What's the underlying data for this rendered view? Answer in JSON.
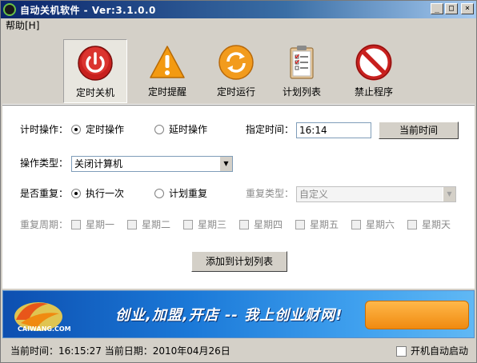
{
  "window": {
    "title": "自动关机软件 - Ver:3.1.0.0",
    "controls": [
      "_",
      "□",
      "×"
    ]
  },
  "menu": {
    "help": "帮助[H]"
  },
  "toolbar": {
    "items": [
      {
        "label": "定时关机",
        "icon": "power-icon",
        "active": true
      },
      {
        "label": "定时提醒",
        "icon": "warning-icon",
        "active": false
      },
      {
        "label": "定时运行",
        "icon": "refresh-icon",
        "active": false
      },
      {
        "label": "计划列表",
        "icon": "clipboard-icon",
        "active": false
      },
      {
        "label": "禁止程序",
        "icon": "forbidden-icon",
        "active": false
      }
    ]
  },
  "form": {
    "timing_label": "计时操作：",
    "timing_options": [
      "定时操作",
      "延时操作"
    ],
    "timing_selected": "定时操作",
    "specified_time_label": "指定时间：",
    "specified_time_value": "16:14",
    "current_time_button": "当前时间",
    "op_type_label": "操作类型：",
    "op_type_value": "关闭计算机",
    "repeat_label": "是否重复：",
    "repeat_options": [
      "执行一次",
      "计划重复"
    ],
    "repeat_selected": "执行一次",
    "repeat_type_label": "重复类型：",
    "repeat_type_value": "自定义",
    "repeat_cycle_label": "重复周期：",
    "weekdays": [
      "星期一",
      "星期二",
      "星期三",
      "星期四",
      "星期五",
      "星期六",
      "星期天"
    ],
    "add_button": "添加到计划列表"
  },
  "banner": {
    "logo_text": "CAIWANG.COM",
    "slogan": "创业,加盟,开店 -- 我上创业财网!"
  },
  "status": {
    "text": "当前时间：16:15:27 当前日期：2010年04月26日",
    "autostart_label": "开机自动启动"
  },
  "colors": {
    "title_bar": "#0a246a",
    "banner_blue": "#1b79d8",
    "banner_orange": "#f08a10"
  }
}
